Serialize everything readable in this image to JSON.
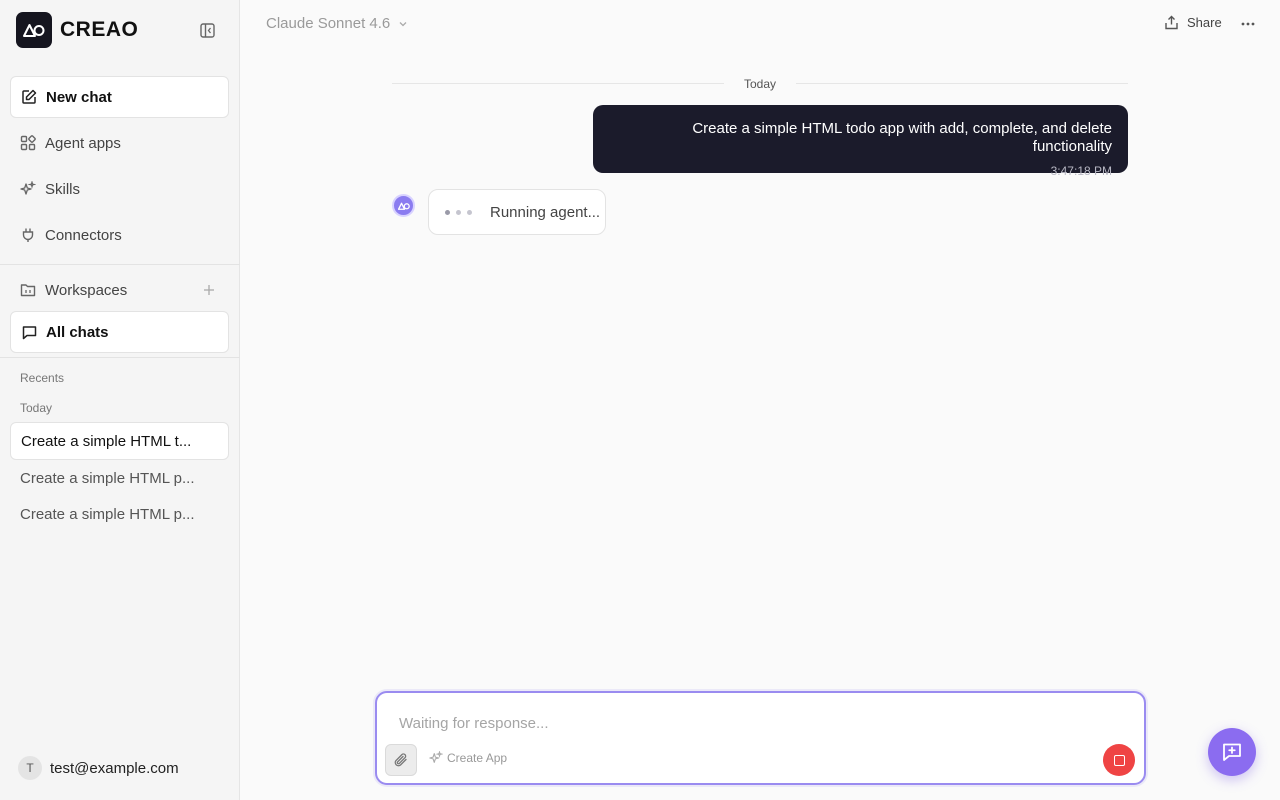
{
  "sidebar": {
    "brand": "CREAO",
    "nav": [
      {
        "label": "New chat",
        "icon": "edit-icon"
      },
      {
        "label": "Agent apps",
        "icon": "apps-icon"
      },
      {
        "label": "Skills",
        "icon": "sparkle-icon"
      },
      {
        "label": "Connectors",
        "icon": "plug-icon"
      }
    ],
    "workspaces_label": "Workspaces",
    "all_chats_label": "All chats",
    "recents_label": "Recents",
    "today_label": "Today",
    "recents": [
      "Create a simple HTML t...",
      "Create a simple HTML p...",
      "Create a simple HTML p..."
    ],
    "user": {
      "initial": "T",
      "email": "test@example.com"
    }
  },
  "header": {
    "model": "Claude Sonnet 4.6",
    "share_label": "Share"
  },
  "chat": {
    "day_label": "Today",
    "user_message": {
      "text": "Create a simple HTML todo app with add, complete, and delete functionality",
      "time": "3:47:18 PM"
    },
    "agent_status": "Running agent..."
  },
  "composer": {
    "placeholder": "Waiting for response...",
    "create_app_label": "Create App"
  },
  "colors": {
    "accent": "#8b6cf0",
    "stop": "#ef4444",
    "user_bubble": "#1b1b2b"
  }
}
